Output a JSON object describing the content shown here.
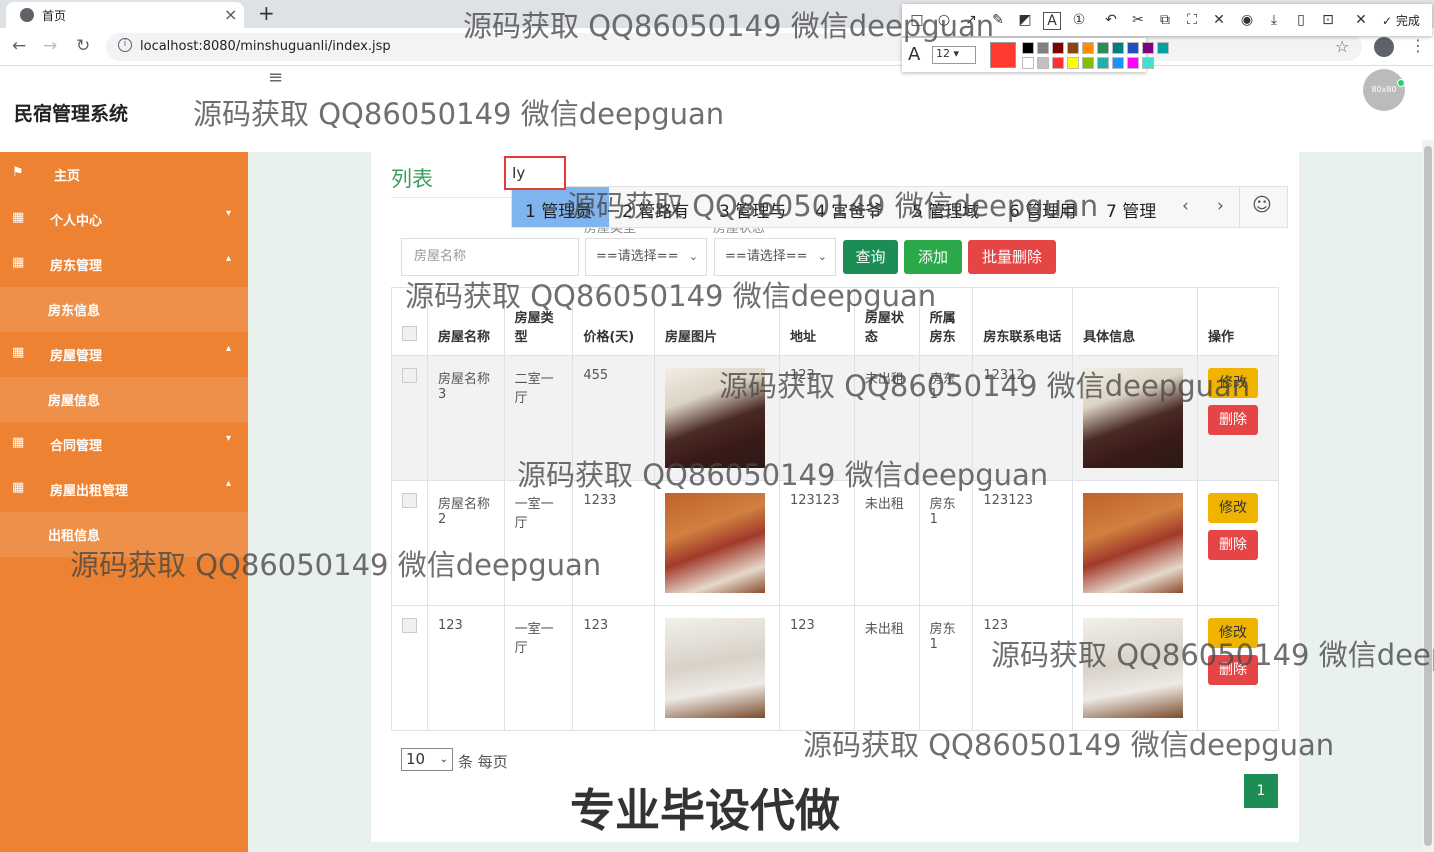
{
  "browser": {
    "tab_title": "首页",
    "tab_close": "×",
    "new_tab": "+",
    "url": "localhost:8080/minshuguanli/index.jsp",
    "back": "←",
    "forward": "→",
    "reload": "↻",
    "info": "i",
    "star": "☆",
    "menu": "⋮"
  },
  "snapshot_tool": {
    "tools": [
      "□",
      "○",
      "↗",
      "✎",
      "◩",
      "A",
      "①",
      "↶",
      "✂",
      "⧉",
      "⛶",
      "✕",
      "◉",
      "⤓",
      "▯",
      "⊡",
      "✕"
    ],
    "done_label": "✓ 完成",
    "font_icon": "A",
    "font_size": "12 ▾",
    "current_color": "#ff3b30",
    "swatches": [
      "#000000",
      "#808080",
      "#800000",
      "#8b4513",
      "#ff8c00",
      "#2e8b57",
      "#008080",
      "#2050c0",
      "#800080",
      "#00a0a0",
      "#ffffff",
      "#c0c0c0",
      "#ff3030",
      "#ffff00",
      "#80c000",
      "#20b2aa",
      "#1e90ff",
      "#ff00ff",
      "#40e0d0"
    ]
  },
  "header": {
    "brand": "民宿管理系统",
    "menu_icon": "≡",
    "avatar": "80x80"
  },
  "sidebar": {
    "items": [
      {
        "icon": "⚑",
        "label": "主页",
        "arrow": ""
      },
      {
        "icon": "▦",
        "label": "个人中心",
        "arrow": "▾"
      },
      {
        "icon": "▦",
        "label": "房东管理",
        "arrow": "▴"
      },
      {
        "icon": "",
        "label": "房东信息",
        "arrow": ""
      },
      {
        "icon": "▦",
        "label": "房屋管理",
        "arrow": "▴"
      },
      {
        "icon": "",
        "label": "房屋信息",
        "arrow": ""
      },
      {
        "icon": "▦",
        "label": "合同管理",
        "arrow": "▾"
      },
      {
        "icon": "▦",
        "label": "房屋出租管理",
        "arrow": "▴"
      },
      {
        "icon": "",
        "label": "出租信息",
        "arrow": ""
      }
    ]
  },
  "main": {
    "list_title": "列表",
    "ime_input_value": "Ⅰy",
    "ime_candidates": [
      "1 管理员",
      "2 管路有",
      "3 管理与",
      "4 宫爸爷",
      "5 管理域",
      "6 管理用",
      "7 管理"
    ],
    "ime_prev": "‹",
    "ime_next": "›",
    "ime_emoji": "☺",
    "filters": {
      "type_label": "房屋类型",
      "status_label": "房屋状态",
      "name_placeholder": "房屋名称",
      "type_select": "==请选择==",
      "status_select": "==请选择==",
      "select_chev": "⌄"
    },
    "buttons": {
      "search": "查询",
      "add": "添加",
      "batch_delete": "批量删除"
    },
    "columns": [
      "房屋名称",
      "房屋类型",
      "价格(天)",
      "房屋图片",
      "地址",
      "房屋状态",
      "所属房东",
      "房东联系电话",
      "具体信息",
      "操作"
    ],
    "rows": [
      {
        "name": "房屋名称3",
        "type": "二室一厅",
        "price": "455",
        "address": "123",
        "status": "未出租",
        "landlord": "房东1",
        "phone": "12312"
      },
      {
        "name": "房屋名称2",
        "type": "一室一厅",
        "price": "1233",
        "address": "123123",
        "status": "未出租",
        "landlord": "房东1",
        "phone": "123123"
      },
      {
        "name": "123",
        "type": "一室一厅",
        "price": "123",
        "address": "123",
        "status": "未出租",
        "landlord": "房东1",
        "phone": "123"
      }
    ],
    "edit_label": "修改",
    "delete_label": "删除",
    "page_size": "10",
    "page_size_suffix": "条 每页",
    "current_page": "1"
  },
  "watermarks": {
    "text": "源码获取 QQ86050149 微信deepguan",
    "partial_text": "源码获取 QQ86050149 微信deep",
    "ad": "专业毕设代做"
  }
}
